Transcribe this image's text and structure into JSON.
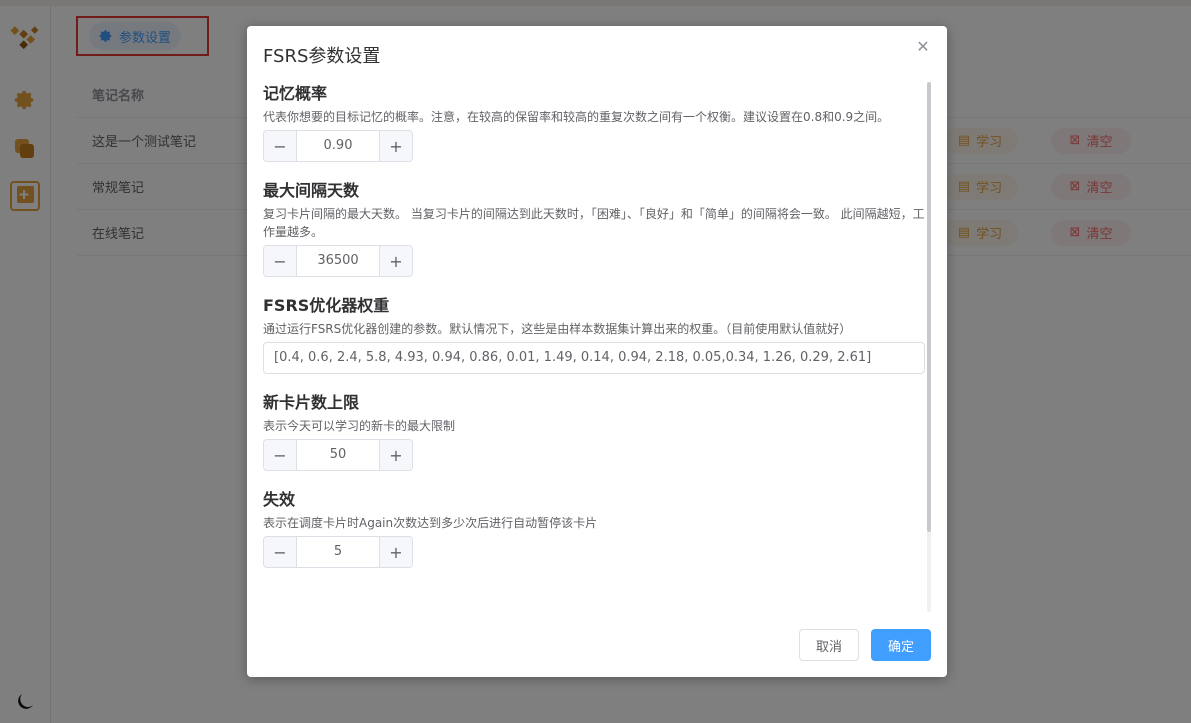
{
  "colors": {
    "accent": "#409eff",
    "warning": "#e6a23c",
    "danger": "#f56c6c",
    "sidebar_icon": "#e6a23c",
    "overlay": "rgba(0,0,0,0.5)"
  },
  "sidebar": {
    "icons": [
      "logo-icon",
      "settings-icon",
      "cards-icon",
      "add-card-icon"
    ],
    "theme_icon": "moon-icon"
  },
  "toolbar": {
    "param_button_label": "参数设置"
  },
  "table": {
    "header_name": "笔记名称",
    "rows": [
      {
        "name": "这是一个测试笔记",
        "learn": "学习",
        "clear": "清空"
      },
      {
        "name": "常规笔记",
        "learn": "学习",
        "clear": "清空"
      },
      {
        "name": "在线笔记",
        "learn": "学习",
        "clear": "清空"
      }
    ]
  },
  "dialog": {
    "title": "FSRS参数设置",
    "retention": {
      "title": "记忆概率",
      "desc": "代表你想要的目标记忆的概率。注意，在较高的保留率和较高的重复次数之间有一个权衡。建议设置在0.8和0.9之间。",
      "value": "0.90"
    },
    "max_interval": {
      "title": "最大间隔天数",
      "desc": "复习卡片间隔的最大天数。 当复习卡片的间隔达到此天数时，「困难」、「良好」和「简单」的间隔将会一致。 此间隔越短，工作量越多。",
      "value": "36500"
    },
    "weights": {
      "title": "FSRS优化器权重",
      "desc": "通过运行FSRS优化器创建的参数。默认情况下，这些是由样本数据集计算出来的权重。（目前使用默认值就好）",
      "value": "[0.4, 0.6, 2.4, 5.8, 4.93, 0.94, 0.86, 0.01, 1.49, 0.14, 0.94, 2.18, 0.05,0.34, 1.26, 0.29, 2.61]"
    },
    "new_cards": {
      "title": "新卡片数上限",
      "desc": "表示今天可以学习的新卡的最大限制",
      "value": "50"
    },
    "lapses": {
      "title": "失效",
      "desc": "表示在调度卡片时Again次数达到多少次后进行自动暂停该卡片",
      "value": "5"
    },
    "cancel_label": "取消",
    "ok_label": "确定"
  }
}
